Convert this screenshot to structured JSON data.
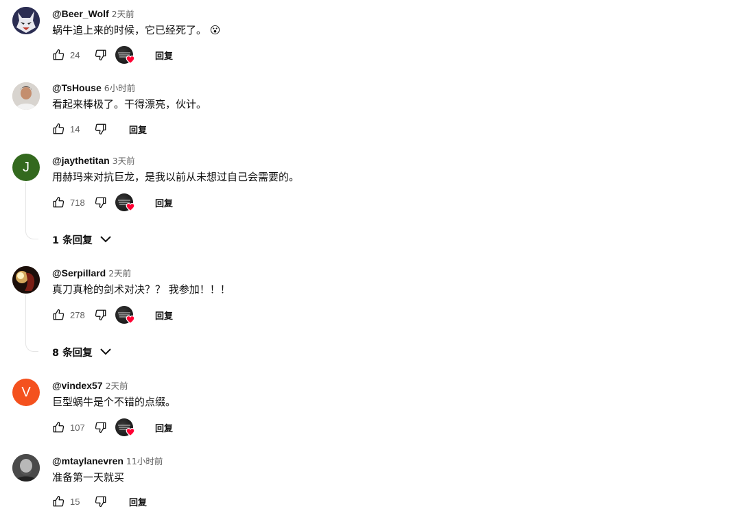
{
  "comments": [
    {
      "author": "@Beer_Wolf",
      "time": "2天前",
      "text": "蜗牛追上来的时候，它已经死了。",
      "emoji": "😮",
      "likes": "24",
      "reply_label": "回复"
    },
    {
      "author": "@TsHouse",
      "time": "6小时前",
      "text": "看起来棒极了。干得漂亮，伙计。",
      "likes": "14",
      "reply_label": "回复"
    },
    {
      "author": "@jaythetitan",
      "time": "3天前",
      "text": "用赫玛来对抗巨龙，是我以前从未想过自己会需要的。",
      "likes": "718",
      "reply_label": "回复",
      "replies_label": "1 条回复",
      "avatar_letter": "J"
    },
    {
      "author": "@Serpillard",
      "time": "2天前",
      "text": "真刀真枪的剑术对决？？ 我参加！！！",
      "likes": "278",
      "reply_label": "回复",
      "replies_label": "8 条回复"
    },
    {
      "author": "@vindex57",
      "time": "2天前",
      "text": "巨型蜗牛是个不错的点缀。",
      "likes": "107",
      "reply_label": "回复",
      "avatar_letter": "V"
    },
    {
      "author": "@mtaylanevren",
      "time": "11小时前",
      "text": "准备第一天就买",
      "likes": "15",
      "reply_label": "回复"
    }
  ],
  "colors": {
    "avatar_j": "#33691e",
    "avatar_v": "#f4511e",
    "heart": "#ff0033",
    "secondary_text": "#606060"
  }
}
